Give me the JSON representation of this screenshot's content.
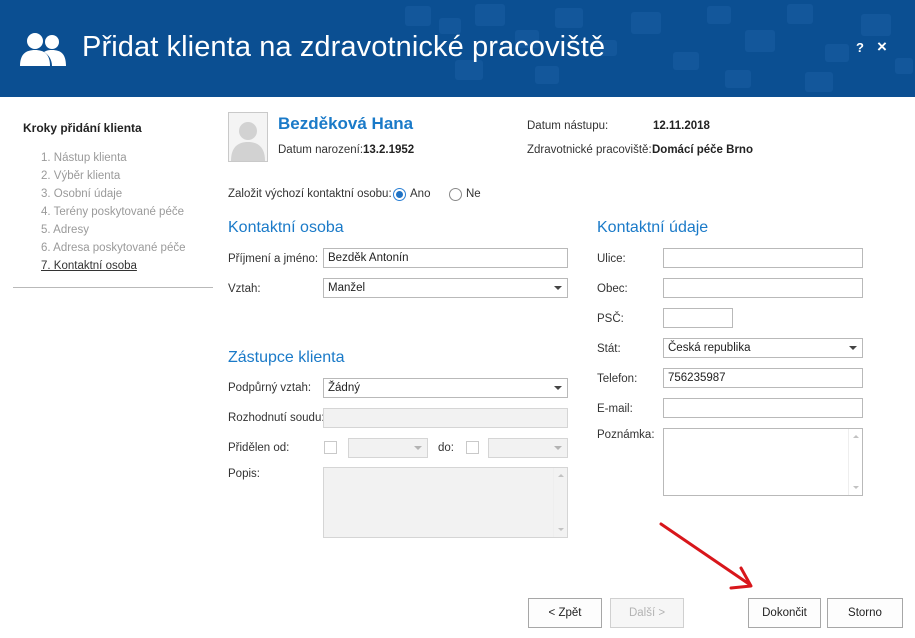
{
  "header": {
    "title": "Přidat klienta na zdravotnické pracoviště",
    "help_label": "?",
    "close_label": "×",
    "bg_color": "#0b4f92"
  },
  "sidebar": {
    "title": "Kroky přidání klienta",
    "steps": [
      "1. Nástup klienta",
      "2. Výběr klienta",
      "3. Osobní údaje",
      "4. Terény poskytované péče",
      "5. Adresy",
      "6. Adresa poskytované péče",
      "7. Kontaktní osoba"
    ],
    "active_step": 7
  },
  "client": {
    "name": "Bezděková Hana",
    "birth_label": "Datum narození:",
    "birth_value": "13.2.1952",
    "start_label": "Datum nástupu:",
    "start_value": "12.11.2018",
    "workplace_label": "Zdravotnické pracoviště:",
    "workplace_value": "Domácí péče Brno"
  },
  "default_contact": {
    "label": "Založit výchozí kontaktní osobu:",
    "yes_label": "Ano",
    "no_label": "Ne",
    "selected": "Ano"
  },
  "contact_person": {
    "title": "Kontaktní osoba",
    "name_label": "Příjmení a jméno:",
    "name_value": "Bezděk Antonín",
    "relation_label": "Vztah:",
    "relation_value": "Manžel"
  },
  "representative": {
    "title": "Zástupce klienta",
    "support_label": "Podpůrný vztah:",
    "support_value": "Žádný",
    "court_label": "Rozhodnutí soudu:",
    "court_value": "",
    "assigned_from_label": "Přidělen od:",
    "to_label": "do:",
    "description_label": "Popis:"
  },
  "contact_details": {
    "title": "Kontaktní údaje",
    "street_label": "Ulice:",
    "street_value": "",
    "city_label": "Obec:",
    "city_value": "",
    "zip_label": "PSČ:",
    "zip_value": "",
    "country_label": "Stát:",
    "country_value": "Česká republika",
    "phone_label": "Telefon:",
    "phone_value": "756235987",
    "email_label": "E-mail:",
    "email_value": "",
    "note_label": "Poznámka:"
  },
  "buttons": {
    "back": "< Zpět",
    "next": "Další >",
    "finish": "Dokončit",
    "cancel": "Storno"
  },
  "colors": {
    "accent": "#1a7ac8",
    "annotation_arrow": "#d8161b"
  }
}
